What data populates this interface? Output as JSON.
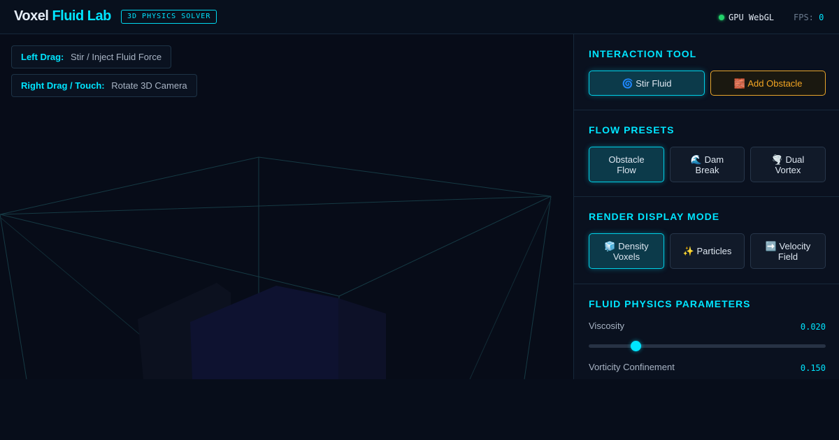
{
  "header": {
    "brand_word1": "Voxel",
    "brand_word2": "Fluid Lab",
    "badge": "3D PHYSICS SOLVER",
    "gpu_label": "GPU WebGL",
    "fps_label": "FPS:",
    "fps_value": "0"
  },
  "hints": [
    {
      "key": "Left Drag:",
      "value": "Stir / Inject Fluid Force"
    },
    {
      "key": "Right Drag / Touch:",
      "value": "Rotate 3D Camera"
    }
  ],
  "panel": {
    "interaction": {
      "title": "INTERACTION TOOL",
      "buttons": [
        {
          "icon": "🌀",
          "label": "Stir Fluid",
          "active": true
        },
        {
          "icon": "🧱",
          "label": "Add Obstacle",
          "active": false
        }
      ]
    },
    "presets": {
      "title": "FLOW PRESETS",
      "buttons": [
        {
          "line1": "Obstacle",
          "line2": "Flow",
          "active": true
        },
        {
          "line1": "🌊 Dam",
          "line2": "Break",
          "active": false
        },
        {
          "line1": "🌪️ Dual",
          "line2": "Vortex",
          "active": false
        }
      ]
    },
    "render": {
      "title": "RENDER DISPLAY MODE",
      "buttons": [
        {
          "line1": "🧊 Density",
          "line2": "Voxels",
          "active": true
        },
        {
          "line1": "✨ Particles",
          "line2": "",
          "active": false
        },
        {
          "line1": "➡️ Velocity",
          "line2": "Field",
          "active": false
        }
      ]
    },
    "physics": {
      "title": "FLUID PHYSICS PARAMETERS",
      "params": [
        {
          "label": "Viscosity",
          "value": "0.020",
          "fraction": 0.2
        },
        {
          "label": "Vorticity Confinement",
          "value": "0.150"
        }
      ]
    }
  },
  "colors": {
    "accent": "#00e5ff",
    "warn": "#f5a623",
    "status_ok": "#22d36a"
  }
}
